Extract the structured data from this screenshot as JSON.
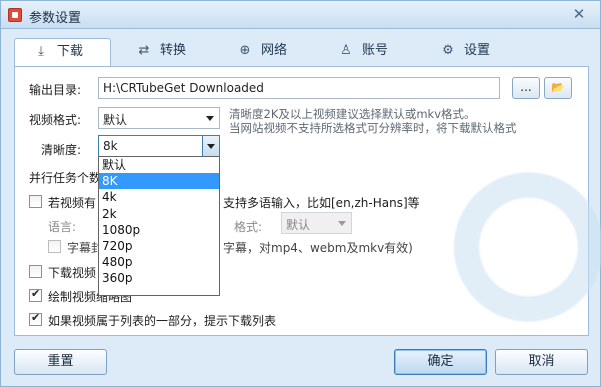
{
  "window": {
    "title": "参数设置"
  },
  "tabs": [
    {
      "label": "下载",
      "icon": "download-icon",
      "glyph": "⤓"
    },
    {
      "label": "转换",
      "icon": "convert-icon",
      "glyph": "⇄"
    },
    {
      "label": "网络",
      "icon": "globe-icon",
      "glyph": "⊕"
    },
    {
      "label": "账号",
      "icon": "user-icon",
      "glyph": "♙"
    },
    {
      "label": "设置",
      "icon": "gear-icon",
      "glyph": "⚙"
    }
  ],
  "output_dir": {
    "label": "输出目录:",
    "value": "H:\\CRTubeGet Downloaded",
    "browse_label": "...",
    "folder_icon": "📂"
  },
  "video_format": {
    "label": "视频格式:",
    "value": "默认",
    "hint_line1": "清晰度2K及以上视频建议选择默认或mkv格式。",
    "hint_line2": "当网站视频不支持所选格式可分辨率时，将下载默认格式"
  },
  "resolution": {
    "label": "清晰度:",
    "value": "8k",
    "options": [
      "默认",
      "8K",
      "4k",
      "2k",
      "1080p",
      "720p",
      "480p",
      "360p"
    ],
    "selected_index": 1
  },
  "parallel": {
    "label": "并行任务个数"
  },
  "subtitles": {
    "checkbox_label_prefix": "若视频有",
    "checkbox_label_suffix": "支持多语输入，比如[en,zh-Hans]等",
    "language_label": "语言:",
    "format_label": "格式:",
    "format_value": "默认",
    "embed_label_prefix": "字幕封",
    "embed_label_suffix": "字幕，对mp4、webm及mkv有效)"
  },
  "options": {
    "download_video_label": "下载视频",
    "draw_thumbnail_label": "绘制视频缩略图",
    "playlist_prompt_label": "如果视频属于列表的一部分，提示下载列表"
  },
  "buttons": {
    "reset": "重置",
    "ok": "确定",
    "cancel": "取消"
  }
}
